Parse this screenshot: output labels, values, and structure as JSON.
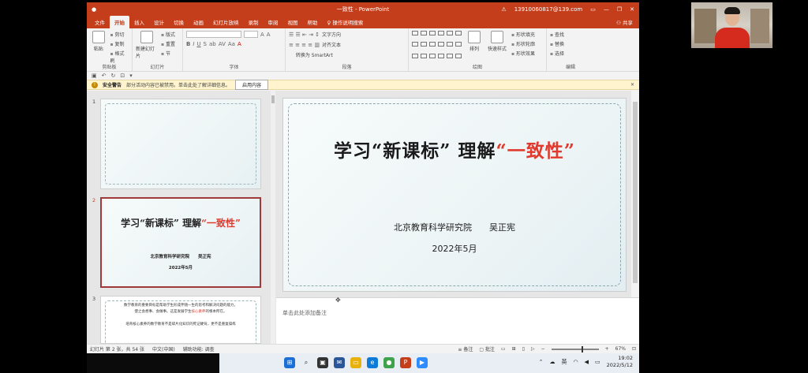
{
  "window": {
    "title": "一致性 - PowerPoint",
    "account": "13910060817@139.com"
  },
  "tabs": [
    "文件",
    "开始",
    "插入",
    "设计",
    "切换",
    "动画",
    "幻灯片放映",
    "录制",
    "审阅",
    "视图",
    "帮助",
    "操作说明搜索"
  ],
  "active_tab": "开始",
  "share_label": "共享",
  "ribbon": {
    "clipboard": {
      "paste": "粘贴",
      "cut": "剪切",
      "copy": "复制",
      "format_painter": "格式刷",
      "label": "剪贴板"
    },
    "slides": {
      "new_slide": "新建幻灯片",
      "layout": "版式",
      "reset": "重置",
      "section": "节",
      "label": "幻灯片"
    },
    "font": {
      "label": "字体",
      "formats": [
        "B",
        "I",
        "U",
        "S",
        "ab",
        "AV",
        "Aa",
        "A"
      ]
    },
    "paragraph": {
      "label": "段落",
      "text_direction": "文字方向",
      "align_text": "对齐文本",
      "smartart": "转换为 SmartArt"
    },
    "drawing": {
      "label": "绘图",
      "arrange": "排列",
      "quick_styles": "快速样式",
      "shape_fill": "形状填充",
      "shape_outline": "形状轮廓",
      "shape_effects": "形状效果"
    },
    "editing": {
      "label": "编辑",
      "find": "查找",
      "replace": "替换",
      "select": "选择"
    }
  },
  "security_bar": {
    "title": "安全警告",
    "message": "部分活动内容已被禁用。单击此处了解详细信息。",
    "button": "启用内容"
  },
  "thumbnails": [
    {
      "num": "1"
    },
    {
      "num": "2",
      "title_black": "学习“新课标” 理解",
      "title_red": "“一致性”",
      "sub": "北京教育科学研究院　　吴正宪",
      "date": "2022年5月"
    },
    {
      "num": "3",
      "line1": "数学教育的重要目标是帮助学生形成伴随一生的思考和解决问题的能力，",
      "line2a": "使之会想事、会做事。这是发展学生",
      "line2red": "核心素养",
      "line2b": "的根本所在。",
      "line3": "培育核心素养的数学教育不是碎片化知识的死记硬背，更不是重复操练"
    }
  ],
  "slide": {
    "title_black": "学习“新课标” 理解",
    "title_red": "“一致性”",
    "subtitle": "北京教育科学研究院　　吴正宪",
    "date": "2022年5月"
  },
  "notes_placeholder": "单击此处添加备注",
  "status": {
    "slide_info": "幻灯片 第 2 张，共 54 张",
    "language": "中文(中国)",
    "accessibility": "辅助功能: 调查",
    "notes": "备注",
    "comments": "批注",
    "zoom": "67%"
  },
  "taskbar": {
    "ime": "英",
    "time": "19:02",
    "date": "2022/5/12"
  }
}
